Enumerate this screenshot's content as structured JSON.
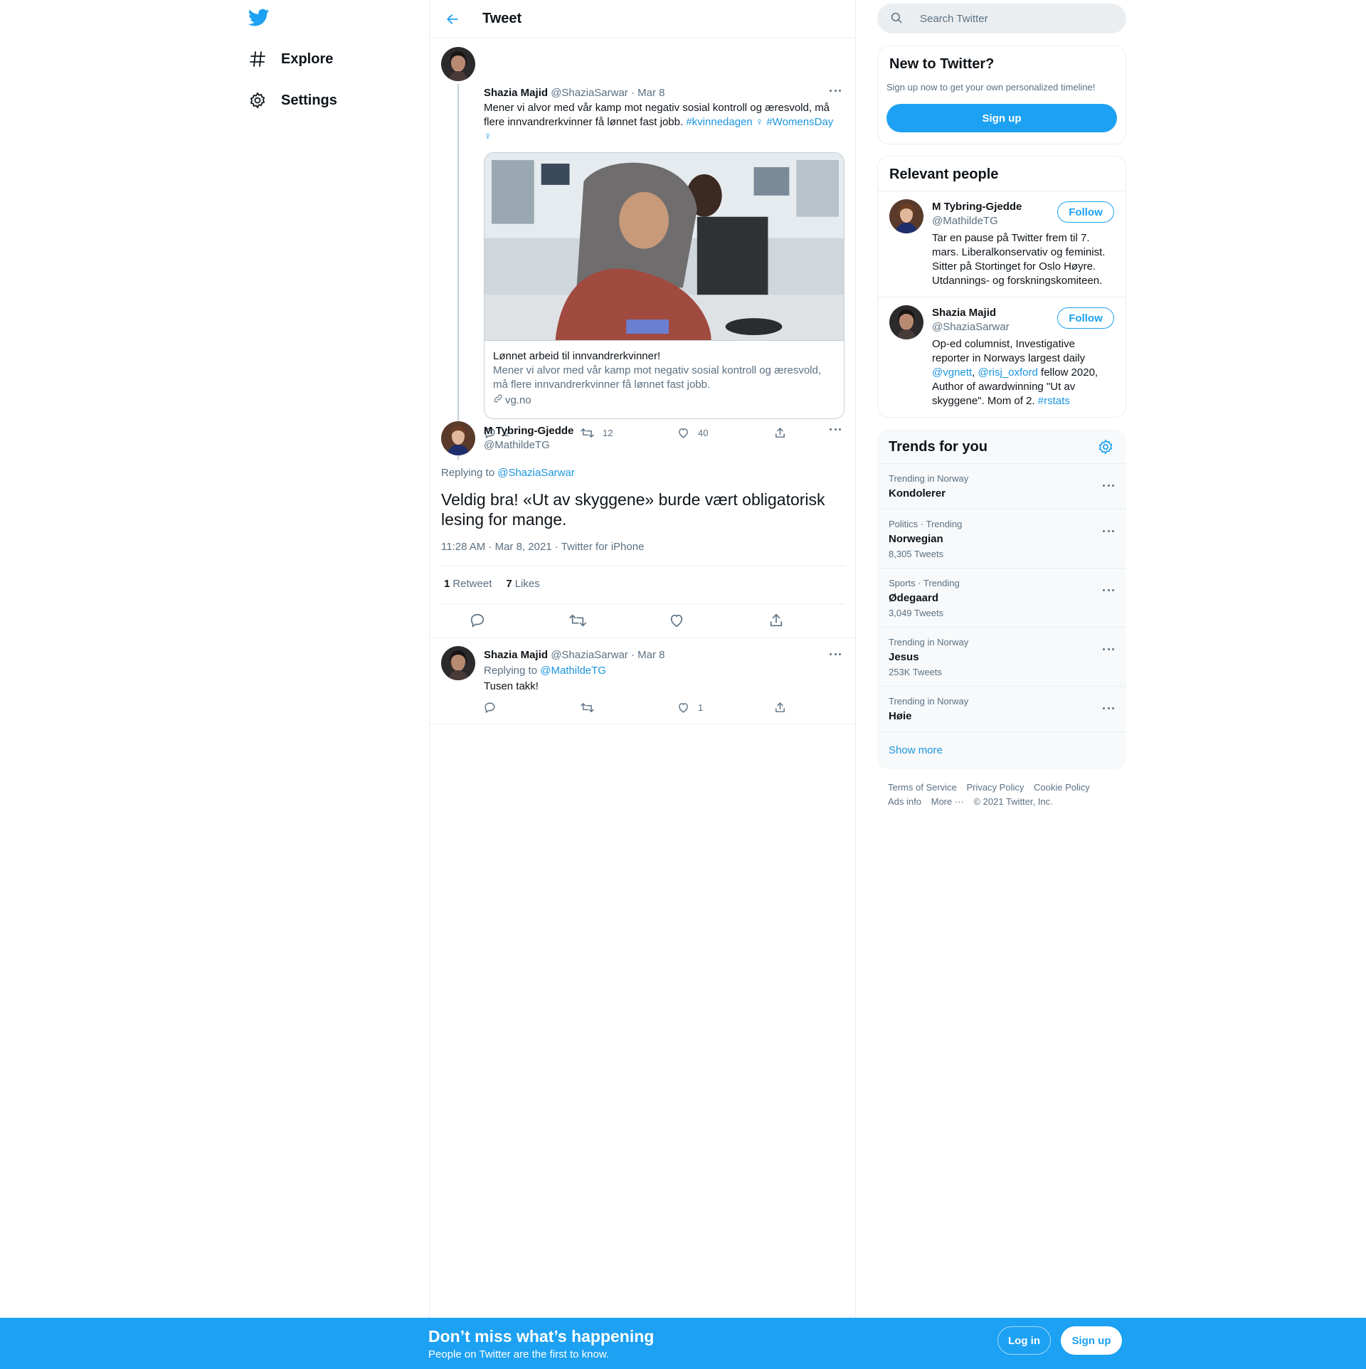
{
  "nav": {
    "logo_icon": "twitter-bird-icon",
    "items": [
      {
        "label": "Explore",
        "icon": "hashtag-icon"
      },
      {
        "label": "Settings",
        "icon": "gear-icon"
      }
    ]
  },
  "header": {
    "title": "Tweet"
  },
  "parent_tweet": {
    "name": "Shazia Majid",
    "handle": "@ShaziaSarwar",
    "date": "· Mar 8",
    "text_line1": "Mener vi alvor med vår kamp mot negativ sosial kontroll og æresvold, må",
    "text_line2": "flere innvandrerkvinner få lønnet fast jobb.",
    "hashtag1": "#kvinnedagen",
    "hashtag2": "#WomensDay",
    "emoji": "♀",
    "card": {
      "title": "Lønnet arbeid til innvandrerkvinner!",
      "description": "Mener vi alvor med vår kamp mot negativ sosial kontroll og æresvold, må flere innvandrerkvinner få lønnet fast jobb.",
      "domain": "vg.no"
    },
    "replies": "2",
    "retweets": "12",
    "likes": "40"
  },
  "main_tweet": {
    "name": "M Tybring-Gjedde",
    "handle": "@MathildeTG",
    "replying_label": "Replying to",
    "replying_to": "@ShaziaSarwar",
    "text": "Veldig bra! «Ut av skyggene» burde vært obligatorisk lesing for mange.",
    "meta": "11:28 AM · Mar 8, 2021 · Twitter for iPhone",
    "retweet_count": "1",
    "retweet_label": "Retweet",
    "like_count": "7",
    "like_label": "Likes"
  },
  "reply_tweet": {
    "name": "Shazia Majid",
    "handle": "@ShaziaSarwar",
    "date": "· Mar 8",
    "replying_label": "Replying to",
    "replying_to": "@MathildeTG",
    "text": "Tusen takk!",
    "likes": "1"
  },
  "search": {
    "placeholder": "Search Twitter"
  },
  "new_to_twitter": {
    "title": "New to Twitter?",
    "subtitle": "Sign up now to get your own personalized timeline!",
    "button": "Sign up"
  },
  "relevant_people": {
    "title": "Relevant people",
    "follow_label": "Follow",
    "people": [
      {
        "name": "M Tybring-Gjedde",
        "handle": "@MathildeTG",
        "bio": [
          "Tar en pause på Twitter frem til 7.",
          "mars. Liberalkonservativ og feminist.",
          "Sitter på Stortinget for Oslo Høyre.",
          "Utdannings- og forskningskomiteen."
        ]
      },
      {
        "name": "Shazia Majid",
        "handle": "@ShaziaSarwar",
        "bio": [
          "Op-ed columnist, Investigative",
          "reporter in Norways largest daily"
        ],
        "bio_mention1": "@vgnett",
        "bio_mention2": "@risj_oxford",
        "bio_after": " fellow 2020,",
        "bio_line4": "Author of awardwinning \"Ut av",
        "bio_line5_pre": "skyggene\". Mom of 2. ",
        "bio_hashtag": "#rstats"
      }
    ]
  },
  "trends": {
    "title": "Trends for you",
    "items": [
      {
        "category": "Trending in Norway",
        "name": "Kondolerer",
        "count": ""
      },
      {
        "category": "Politics · Trending",
        "name": "Norwegian",
        "count": "8,305 Tweets"
      },
      {
        "category": "Sports · Trending",
        "name": "Ødegaard",
        "count": "3,049 Tweets"
      },
      {
        "category": "Trending in Norway",
        "name": "Jesus",
        "count": "253K Tweets"
      },
      {
        "category": "Trending in Norway",
        "name": "Høie",
        "count": ""
      }
    ],
    "show_more": "Show more"
  },
  "footer": {
    "terms": "Terms of Service",
    "privacy": "Privacy Policy",
    "cookie": "Cookie Policy",
    "ads": "Ads info",
    "more": "More ···",
    "copyright": "© 2021 Twitter, Inc."
  },
  "bottom_bar": {
    "title": "Don’t miss what’s happening",
    "subtitle": "People on Twitter are the first to know.",
    "login": "Log in",
    "signup": "Sign up"
  },
  "colors": {
    "accent": "#1da1f2",
    "link": "#1b95e0",
    "muted": "#5b7083"
  }
}
